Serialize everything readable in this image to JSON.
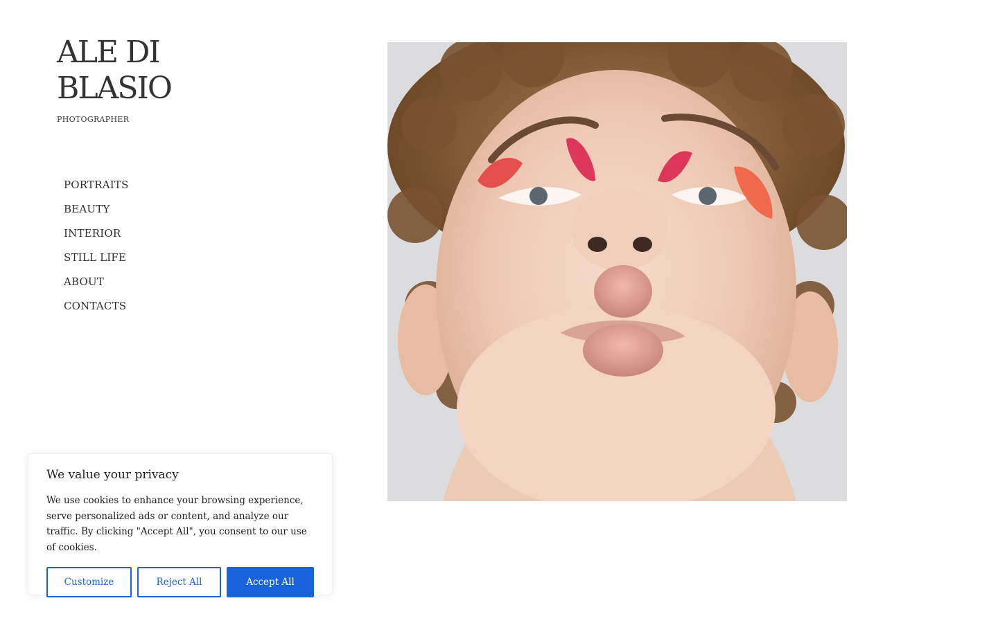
{
  "brand": {
    "line1": "ALE DI",
    "line2": "BLASIO",
    "tagline": "PHOTOGRAPHER"
  },
  "nav": [
    {
      "label": "PORTRAITS"
    },
    {
      "label": "BEAUTY"
    },
    {
      "label": "INTERIOR"
    },
    {
      "label": "STILL LIFE"
    },
    {
      "label": "ABOUT"
    },
    {
      "label": "CONTACTS"
    }
  ],
  "hero": {
    "icon": "portrait-photo"
  },
  "social": {
    "icons": [
      "facebook-icon",
      "instagram-icon"
    ]
  },
  "cookie_banner": {
    "title": "We value your privacy",
    "body": "We use cookies to enhance your browsing experience, serve personalized ads or content, and analyze our traffic. By clicking \"Accept All\", you consent to our use of cookies.",
    "customize_label": "Customize",
    "reject_label": "Reject All",
    "accept_label": "Accept All"
  },
  "colors": {
    "accent": "#1863dc",
    "text": "#2f2f2f"
  }
}
